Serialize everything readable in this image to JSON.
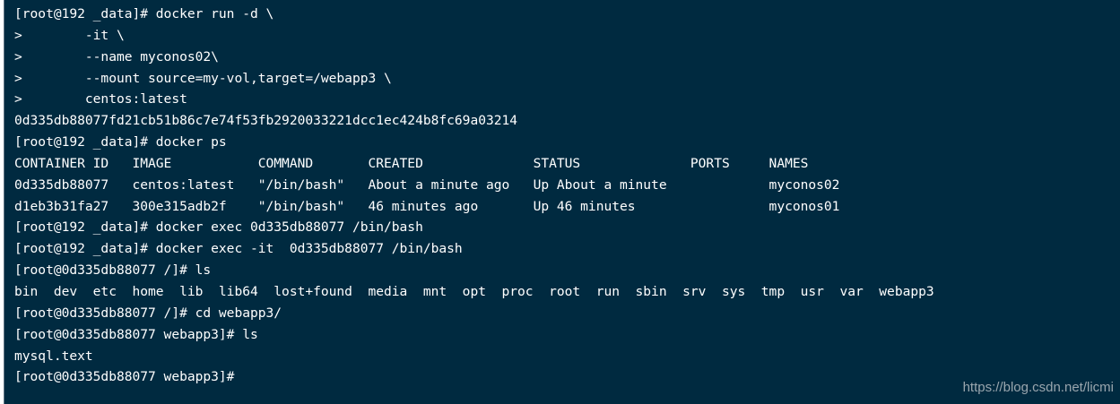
{
  "terminal": {
    "lines": [
      "[root@192 _data]# docker run -d \\",
      ">        -it \\",
      ">        --name myconos02\\",
      ">        --mount source=my-vol,target=/webapp3 \\",
      ">        centos:latest",
      "0d335db88077fd21cb51b86c7e74f53fb2920033221dcc1ec424b8fc69a03214",
      "[root@192 _data]# docker ps",
      "CONTAINER ID   IMAGE           COMMAND       CREATED              STATUS              PORTS     NAMES",
      "0d335db88077   centos:latest   \"/bin/bash\"   About a minute ago   Up About a minute             myconos02",
      "d1eb3b31fa27   300e315adb2f    \"/bin/bash\"   46 minutes ago       Up 46 minutes                 myconos01",
      "[root@192 _data]# docker exec 0d335db88077 /bin/bash",
      "[root@192 _data]# docker exec -it  0d335db88077 /bin/bash",
      "[root@0d335db88077 /]# ls",
      "bin  dev  etc  home  lib  lib64  lost+found  media  mnt  opt  proc  root  run  sbin  srv  sys  tmp  usr  var  webapp3",
      "[root@0d335db88077 /]# cd webapp3/",
      "[root@0d335db88077 webapp3]# ls",
      "mysql.text",
      "[root@0d335db88077 webapp3]#"
    ]
  },
  "watermark": "https://blog.csdn.net/licmi"
}
